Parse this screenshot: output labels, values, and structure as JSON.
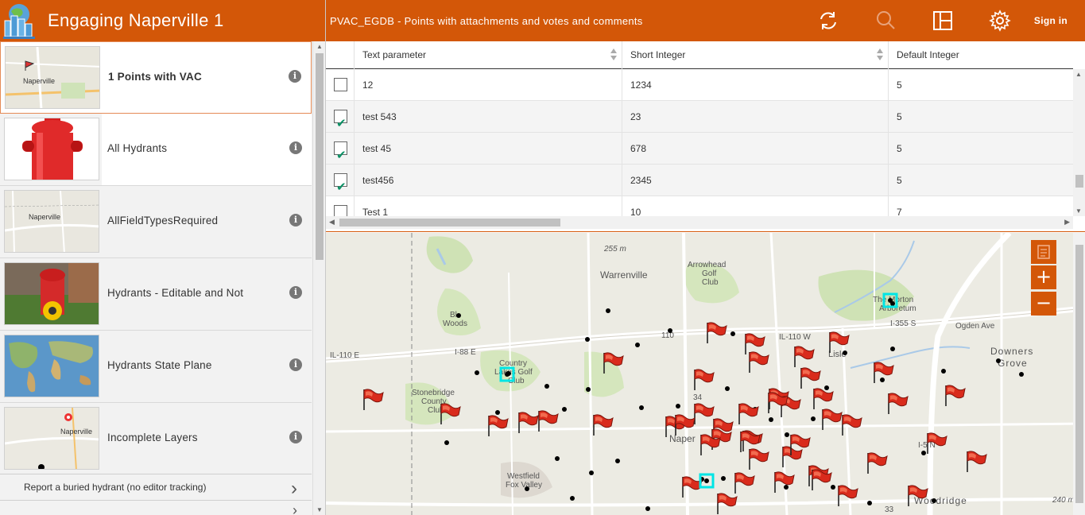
{
  "app": {
    "title": "Engaging Naperville 1"
  },
  "layers": [
    {
      "label": "1 Points with VAC",
      "thumb_text": "Naperville",
      "selected": true
    },
    {
      "label": "All Hydrants"
    },
    {
      "label": "AllFieldTypesRequired",
      "thumb_text": "Naperville"
    },
    {
      "label": "Hydrants - Editable and Not"
    },
    {
      "label": "Hydrants State Plane"
    },
    {
      "label": "Incomplete Layers",
      "thumb_text": "Naperville"
    }
  ],
  "left_links": {
    "report": "Report a buried hydrant (no editor tracking)"
  },
  "topbar": {
    "table_title": "PVAC_EGDB - Points with attachments and votes and comments",
    "signin_label": "Sign in",
    "icons": [
      "refresh-icon",
      "search-icon",
      "layout-icon",
      "gear-icon"
    ]
  },
  "table": {
    "columns": [
      "Text parameter",
      "Short Integer",
      "Default Integer"
    ],
    "rows": [
      {
        "checked": false,
        "text": "12",
        "short": "1234",
        "default": "5"
      },
      {
        "checked": true,
        "text": "test 543",
        "short": "23",
        "default": "5"
      },
      {
        "checked": true,
        "text": "test 45",
        "short": "678",
        "default": "5"
      },
      {
        "checked": true,
        "text": "test456",
        "short": "2345",
        "default": "5"
      },
      {
        "checked": false,
        "text": "Test 1",
        "short": "10",
        "default": "7"
      }
    ]
  },
  "map": {
    "labels": {
      "warrenville": "Warrenville",
      "arrowhead": "Arrowhead",
      "golf": "Golf",
      "club": "Club",
      "morton": "The Morton",
      "arboretum": "Arboretum",
      "downers": "Downers",
      "grove": "Grove",
      "lisle": "Lisle",
      "country": "Country",
      "lakes": "Lakes Golf",
      "club2": "Club",
      "stonebridge": "Stonebridge",
      "county": "County",
      "club3": "Club",
      "westfield": "Westfield",
      "foxvalley": "Fox Valley",
      "woodridge": "Woodridge",
      "naperville": "Naper",
      "blackwoods": "Bl",
      "woods": "Woods",
      "elev1": "255 m",
      "elev2": "240 m",
      "ogden": "Ogden Ave",
      "il110w": "IL-110 W",
      "i88e": "I-88 E",
      "il110e": "IL-110 E",
      "i355s": "I-355 S",
      "r110": "110",
      "r34": "34",
      "r33": "33",
      "i5n": "I-5 N"
    },
    "zoom_in": "+",
    "zoom_out": "−",
    "colors": {
      "accent": "#d35708",
      "select": "#00e5e5"
    }
  }
}
